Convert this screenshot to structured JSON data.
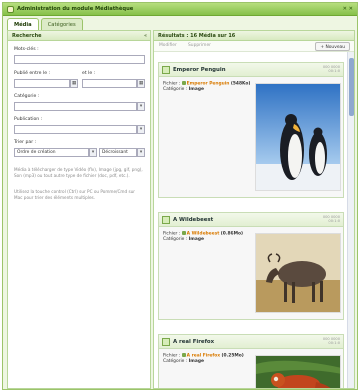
{
  "window": {
    "title": "Administration du module Médiathèque",
    "controls": "✕ ✕"
  },
  "tabs": [
    {
      "label": "Média"
    },
    {
      "label": "Catégories"
    }
  ],
  "left_panel": {
    "header": "Recherche",
    "fields": {
      "mots_cles": {
        "label": "Mots-clés :",
        "value": ""
      },
      "publie_entre": {
        "label": "Publié entre le :",
        "value": ""
      },
      "et_le": {
        "label": "et le :",
        "value": ""
      },
      "categorie": {
        "label": "Catégorie :",
        "value": ""
      },
      "publication": {
        "label": "Publication :",
        "value": ""
      },
      "trier_par": {
        "label": "Trier par :",
        "value": "Ordre de création",
        "order": "Décroissant"
      }
    },
    "help1": "Média à télécharger de type Vidéo (flv), Image (jpg, gif, png), Son (mp3) ou tout autre type de fichier (doc, pdf, etc.).",
    "help2": "Utilisez la touche control (Ctrl) sur PC ou Pomme/Cmd sur Mac pour trier des éléments multiples."
  },
  "right_panel": {
    "header": "Résultats : 16 Média sur 16",
    "toolbar": {
      "modify": "Modifier",
      "delete": "Supprimer",
      "new": "+ Nouveau"
    },
    "items": [
      {
        "title": "Emperor Penguin",
        "file_label": "Fichier :",
        "file_name": "Emperor Penguin",
        "file_size": "(548Ko)",
        "cat_label": "Catégorie :",
        "category": "Image",
        "meta1": "000 0000",
        "meta2": "00:1:0"
      },
      {
        "title": "A Wildebeest",
        "file_label": "Fichier :",
        "file_name": "A Wildebeest",
        "file_size": "(0.86Mo)",
        "cat_label": "Catégorie :",
        "category": "Image",
        "meta1": "000 0000",
        "meta2": "00:1:0"
      },
      {
        "title": "A real Firefox",
        "file_label": "Fichier :",
        "file_name": "A real Firefox",
        "file_size": "(0.25Mo)",
        "cat_label": "Catégorie :",
        "category": "Image",
        "meta1": "000 0000",
        "meta2": "00:1:0"
      }
    ]
  },
  "icons": [
    "window-icon",
    "media-item-icon",
    "file-icon",
    "calendar-icon",
    "dropdown-arrow-icon"
  ],
  "colors": {
    "title_bar": "#9ccf5f",
    "accent_file": "#d97a00",
    "scroll_thumb": "#8fa8cf"
  }
}
